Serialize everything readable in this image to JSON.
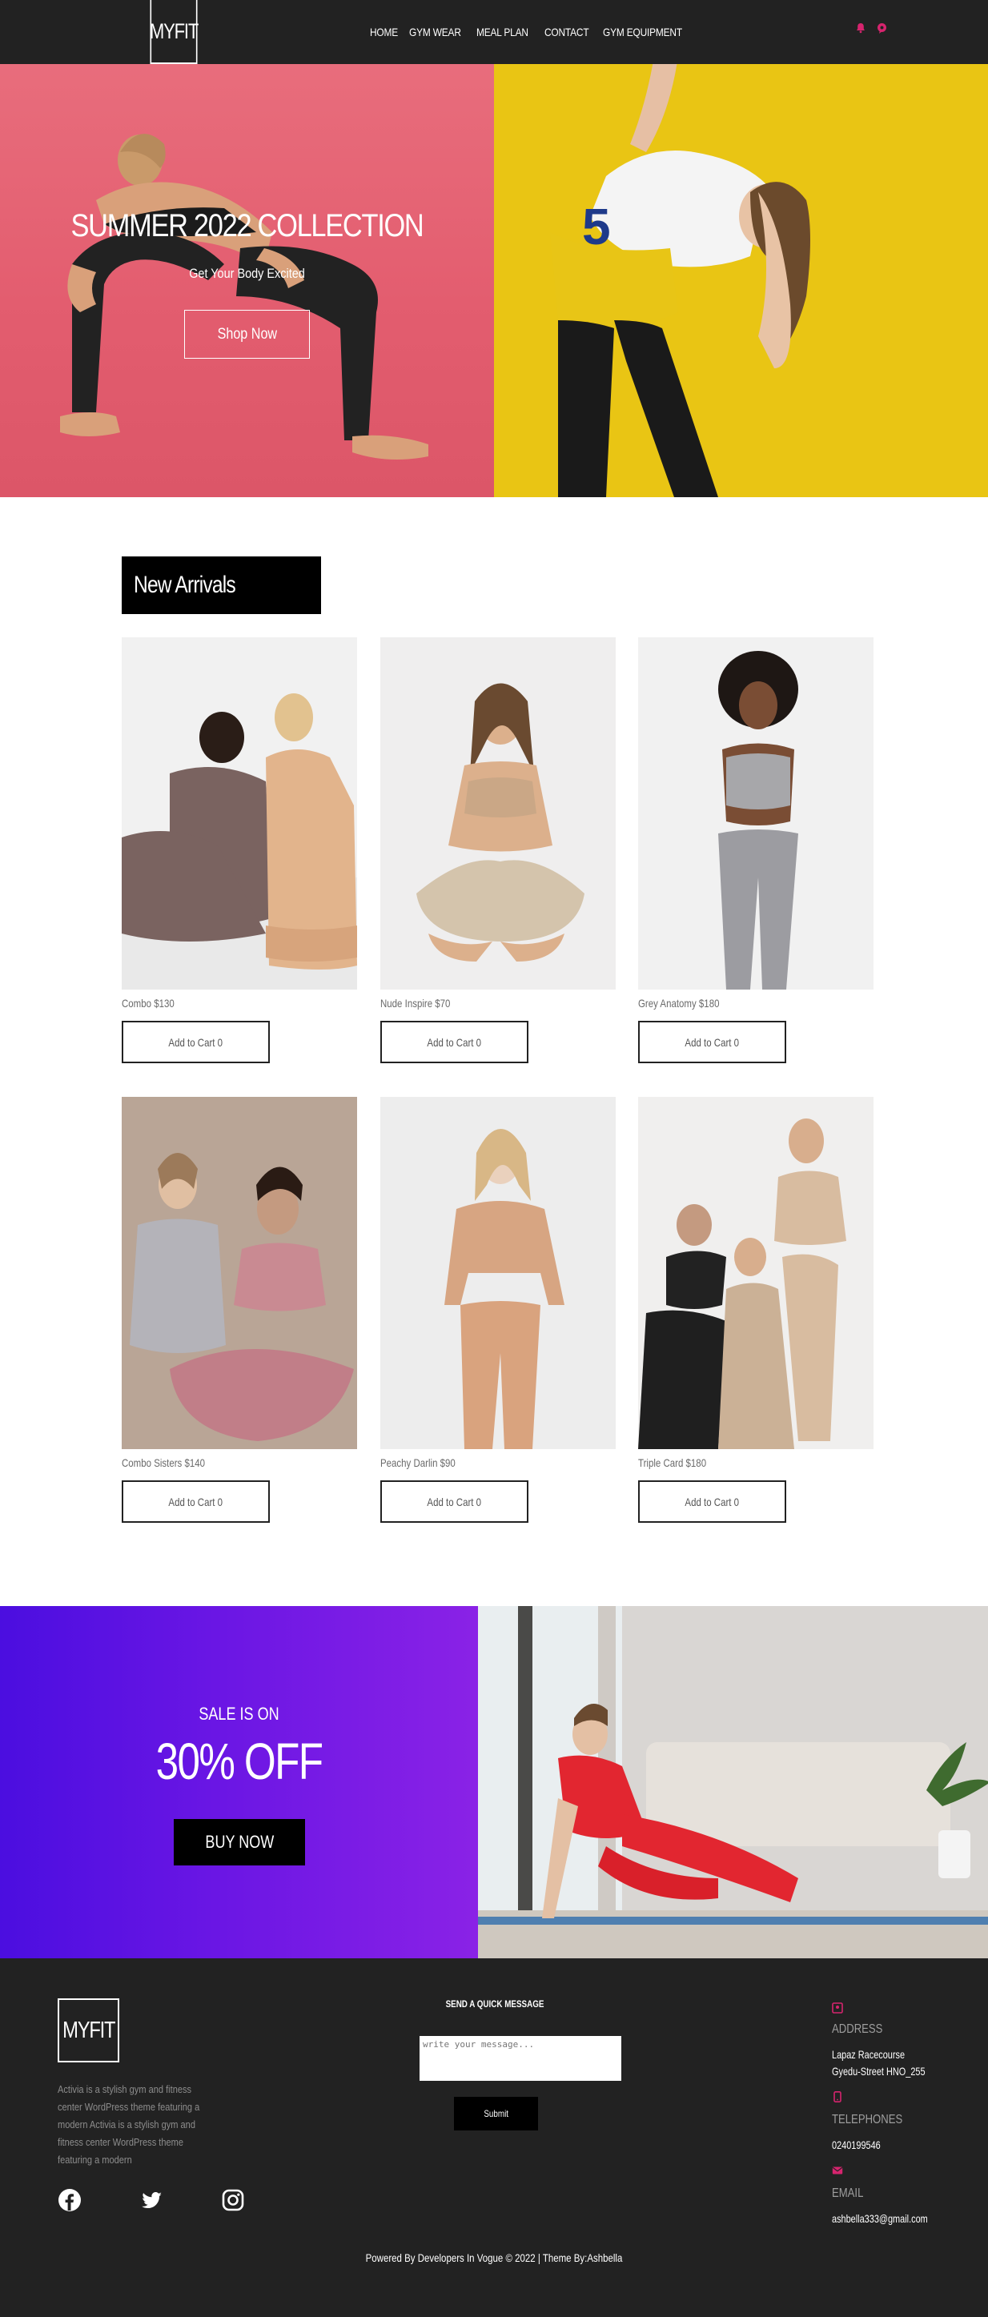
{
  "brand": {
    "logo_text": "MYFIT"
  },
  "nav": {
    "items": [
      {
        "label": "HOME"
      },
      {
        "label": "GYM WEAR"
      },
      {
        "label": "MEAL PLAN"
      },
      {
        "label": "CONTACT"
      },
      {
        "label": "GYM EQUIPMENT"
      }
    ],
    "icons": [
      "bell-icon",
      "chat-icon"
    ],
    "icon_color": "#d6246e"
  },
  "hero": {
    "title": "SUMMER 2022 COLLECTION",
    "subtitle": "Get Your Body Excited",
    "button_label": "Shop Now",
    "left_color": "#e4606f",
    "right_color": "#e9c514"
  },
  "arrivals": {
    "title": "New Arrivals",
    "products": [
      {
        "name": "Combo $130",
        "button_label": "Add to Cart 0"
      },
      {
        "name": "Nude Inspire $70",
        "button_label": "Add to Cart 0"
      },
      {
        "name": "Grey Anatomy $180",
        "button_label": "Add to Cart 0"
      },
      {
        "name": "Combo Sisters $140",
        "button_label": "Add to Cart 0"
      },
      {
        "name": "Peachy Darlin $90",
        "button_label": "Add to Cart 0"
      },
      {
        "name": "Triple Card $180",
        "button_label": "Add to Cart 0"
      }
    ]
  },
  "sale": {
    "kicker": "SALE IS ON",
    "headline": "30% OFF",
    "button_label": "BUY NOW"
  },
  "footer": {
    "logo_text": "MYFIT",
    "description": "Activia is a stylish gym and fitness center WordPress theme featuring a modern Activia is a stylish gym and fitness center WordPress theme featuring a modern",
    "social": [
      "facebook-icon",
      "twitter-icon",
      "instagram-icon"
    ],
    "message": {
      "title": "SEND A QUICK MESSAGE",
      "placeholder": "write your message...",
      "submit_label": "Submit"
    },
    "contact": {
      "address_label": "ADDRESS",
      "address_line1": "Lapaz Racecourse",
      "address_line2": "Gyedu-Street HNO_255",
      "phone_label": "TELEPHONES",
      "phone": "0240199546",
      "email_label": "EMAIL",
      "email": "ashbella333@gmail.com"
    },
    "copyright": "Powered By Developers In Vogue © 2022 | Theme By:Ashbella"
  }
}
